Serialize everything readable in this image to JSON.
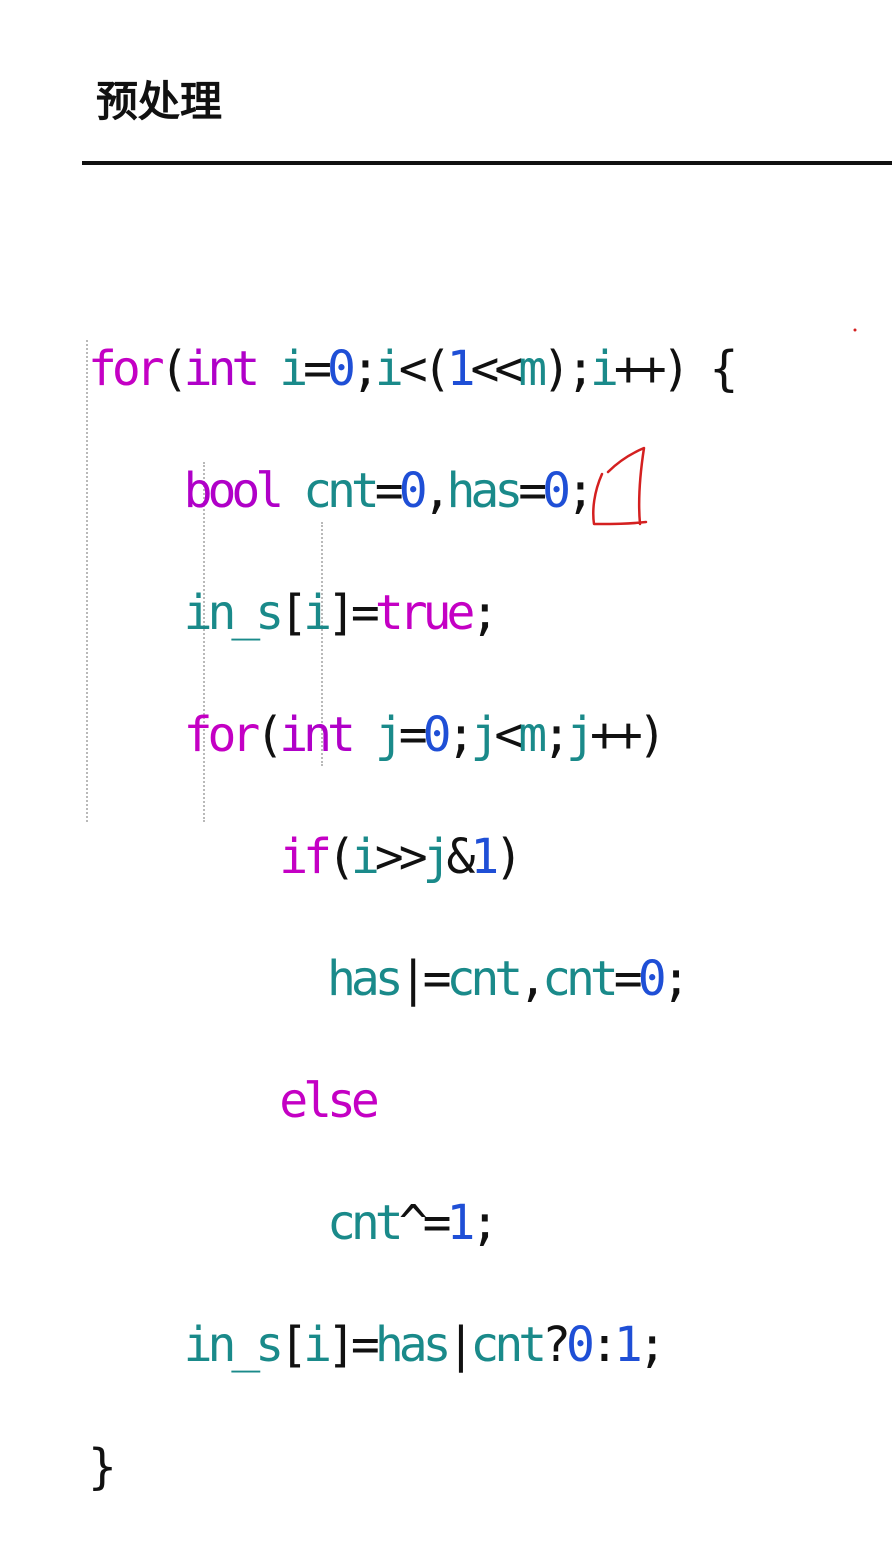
{
  "heading": "预处理",
  "code": {
    "line1": {
      "kw": "for",
      "open": "(",
      "type": "int",
      "var": "i",
      "eq": "=",
      "zero": "0",
      "semi1": ";",
      "var2": "i",
      "lt": "<",
      "open2": "(",
      "one": "1",
      "shl": "<<",
      "m": "m",
      "close2": ")",
      "semi2": ";",
      "var3": "i",
      "inc": "++",
      "close": ")",
      "brace": " {"
    },
    "line2": {
      "type": "bool",
      "cnt": "cnt",
      "eq1": "=",
      "zero1": "0",
      "comma": ",",
      "has": "has",
      "eq2": "=",
      "zero2": "0",
      "semi": ";"
    },
    "line3": {
      "arr": "in_s",
      "lb": "[",
      "idx": "i",
      "rb": "]",
      "eq": "=",
      "val": "true",
      "semi": ";"
    },
    "line4": {
      "kw": "for",
      "open": "(",
      "type": "int",
      "var": "j",
      "eq": "=",
      "zero": "0",
      "semi1": ";",
      "var2": "j",
      "lt": "<",
      "m": "m",
      "semi2": ";",
      "var3": "j",
      "inc": "++",
      "close": ")"
    },
    "line5": {
      "kw": "if",
      "open": "(",
      "i": "i",
      "shr": ">>",
      "j": "j",
      "amp": "&",
      "one": "1",
      "close": ")"
    },
    "line6": {
      "has": "has",
      "oreq": "|=",
      "cnt": "cnt",
      "comma": ",",
      "cnt2": "cnt",
      "eq": "=",
      "zero": "0",
      "semi": ";"
    },
    "line7": {
      "kw": "else"
    },
    "line8": {
      "cnt": "cnt",
      "xoreq": "^=",
      "one": "1",
      "semi": ";"
    },
    "line9": {
      "arr": "in_s",
      "lb": "[",
      "idx": "i",
      "rb": "]",
      "eq": "=",
      "has": "has",
      "or": "|",
      "cnt": "cnt",
      "q": "?",
      "zero": "0",
      "colon": ":",
      "one": "1",
      "semi": ";"
    },
    "line10": {
      "brace": "}"
    }
  },
  "colors": {
    "keyword": "#c400c4",
    "type": "#b000c8",
    "identifier": "#1a8a8a",
    "number": "#1f4fd6",
    "punctuation": "#111111",
    "annotation": "#d42020"
  }
}
